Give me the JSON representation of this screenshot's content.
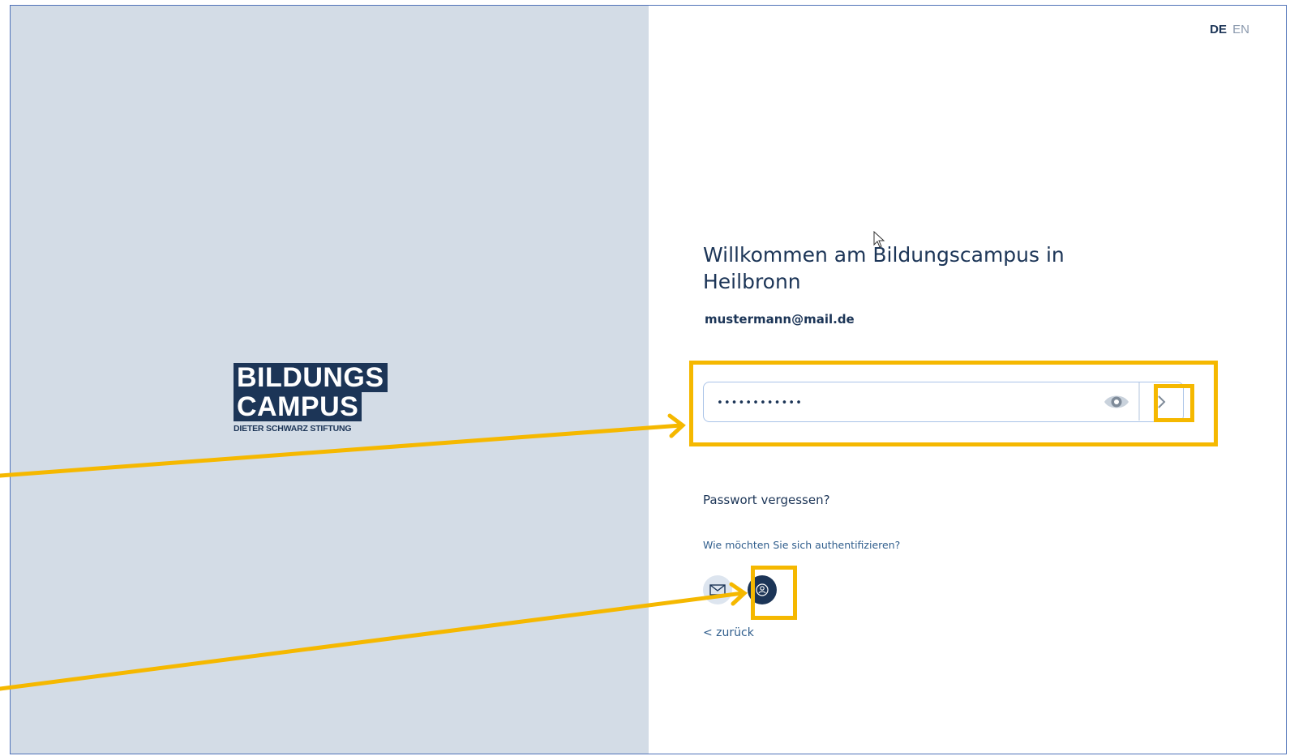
{
  "lang": {
    "de": "DE",
    "en": "EN"
  },
  "logo": {
    "line1": "BILDUNGS",
    "line2": "CAMPUS",
    "sub": "DIETER SCHWARZ STIFTUNG"
  },
  "title": "Willkommen am Bildungscampus in Heilbronn",
  "email": "mustermann@mail.de",
  "password": {
    "masked_value": "••••••••••••",
    "show_icon": "eye-icon",
    "next_icon": "chevron-right-icon"
  },
  "forgot_link": "Passwort vergessen?",
  "auth_question": "Wie möchten Sie sich authentifizieren?",
  "auth_options": [
    {
      "icon": "mail-icon"
    },
    {
      "icon": "passkey-icon"
    }
  ],
  "back_link": "< zurück",
  "colors": {
    "brand_navy": "#1c3557",
    "left_panel": "#d3dce6",
    "highlight": "#f5b800",
    "input_border": "#a9c3e8"
  }
}
